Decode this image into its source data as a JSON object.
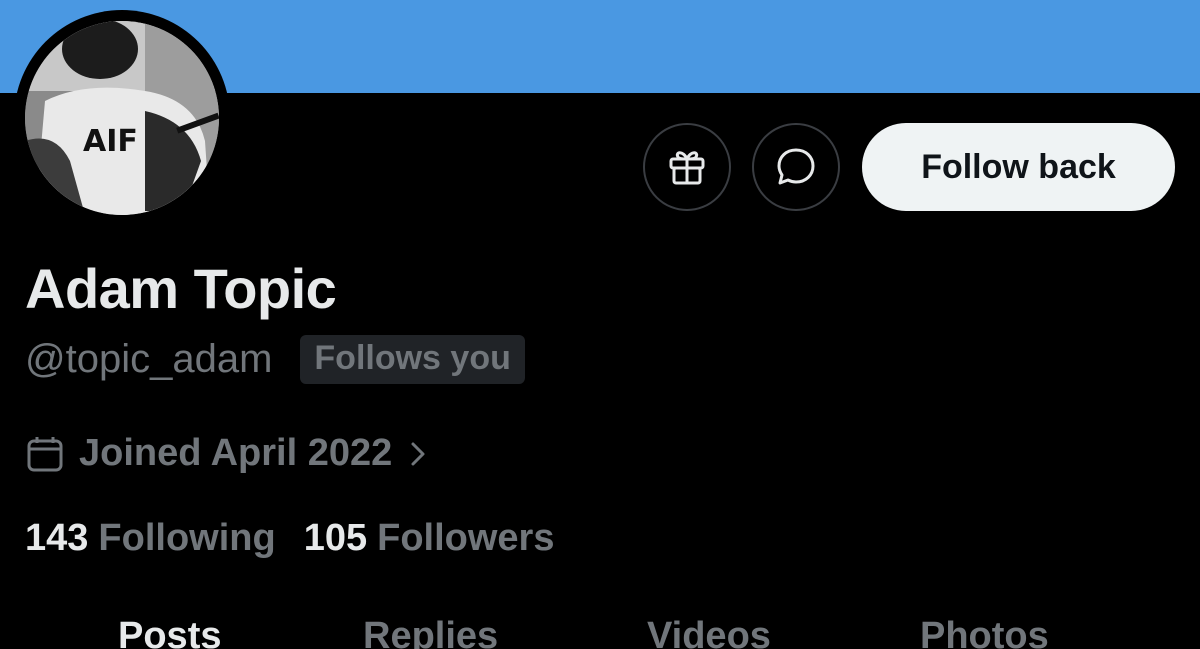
{
  "profile": {
    "name": "Adam Topic",
    "handle": "@topic_adam",
    "follows_badge": "Follows you",
    "joined": "Joined April 2022",
    "avatar_shirt_logo": "AIF"
  },
  "stats": {
    "following_count": "143",
    "following_label": "Following",
    "followers_count": "105",
    "followers_label": "Followers"
  },
  "actions": {
    "follow_back_label": "Follow back",
    "gift_icon": "gift-icon",
    "message_icon": "message-bubble-icon"
  },
  "tabs": [
    {
      "label": "Posts",
      "active": true
    },
    {
      "label": "Replies",
      "active": false
    },
    {
      "label": "Videos",
      "active": false
    },
    {
      "label": "Photos",
      "active": false
    }
  ],
  "colors": {
    "banner": "#4a98e2",
    "background": "#000000",
    "primary_text": "#e7e9ea",
    "secondary_text": "#71767b",
    "follow_button_bg": "#eff3f4"
  }
}
